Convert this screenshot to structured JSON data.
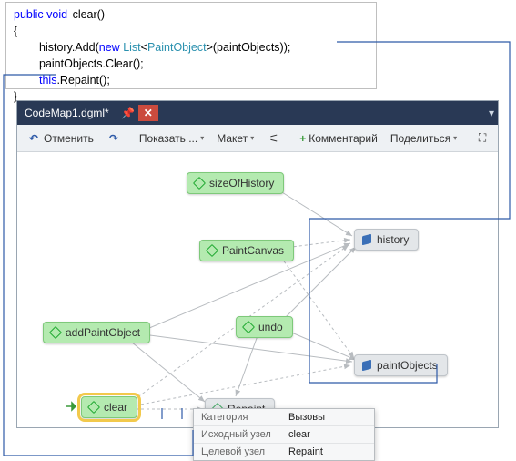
{
  "code": {
    "kw_public": "public",
    "kw_void": "void",
    "fn": "clear",
    "parens": "()",
    "lbrace": "{",
    "line1_a": "history.Add(",
    "line1_kw_new": "new",
    "line1_typ": "List",
    "line1_generic_open": "<",
    "line1_generic_typ": "PaintObject",
    "line1_generic_close": ">",
    "line1_b": "(paintObjects));",
    "line2": "paintObjects.Clear();",
    "line3_kw": "this",
    "line3_b": ".Repaint();",
    "rbrace": "}"
  },
  "codemap": {
    "title": "CodeMap1.dgml*",
    "toolbar": {
      "undo_icon": "↶",
      "undo_label": "Отменить",
      "redo_icon": "↷",
      "show_label": "Показать ...",
      "layout_label": "Макет",
      "find_icon": "⌕",
      "comment_plus": "+",
      "comment_label": "Комментарий",
      "share_label": "Поделиться",
      "expand_icon": "⛶"
    },
    "nodes": {
      "sizeOfHistory": "sizeOfHistory",
      "PaintCanvas": "PaintCanvas",
      "addPaintObject": "addPaintObject",
      "undo": "undo",
      "clear": "clear",
      "Repaint": "Repaint",
      "history": "history",
      "paintObjects": "paintObjects"
    }
  },
  "tooltip": {
    "row1_k": "Категория",
    "row1_v": "Вызовы",
    "row2_k": "Исходный узел",
    "row2_v": "clear",
    "row3_k": "Целевой узел",
    "row3_v": "Repaint"
  }
}
